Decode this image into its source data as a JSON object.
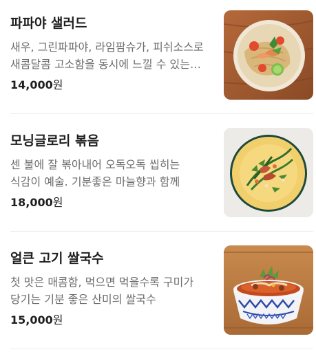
{
  "menu": {
    "items": [
      {
        "name": "파파야 샐러드",
        "description": "새우, 그린파파야, 라임팜슈가, 피쉬소스로 새콤달콤 고소함을 동시에 느낄 수 있는 샐러드",
        "price": "14,000",
        "currency": "원",
        "image_icon": "papaya-salad-photo"
      },
      {
        "name": "모닝글로리 볶음",
        "description": "센 불에 잘 볶아내어 오독오독 씹히는 식감이 예술. 기분좋은 마늘향과 함께",
        "price": "18,000",
        "currency": "원",
        "image_icon": "morning-glory-photo"
      },
      {
        "name": "얼큰 고기 쌀국수",
        "description": "첫 맛은 매콤함, 먹으면 먹을수록 구미가 당기는 기분 좋은 산미의 쌀국수",
        "price": "15,000",
        "currency": "원",
        "image_icon": "beef-noodle-soup-photo"
      }
    ]
  }
}
